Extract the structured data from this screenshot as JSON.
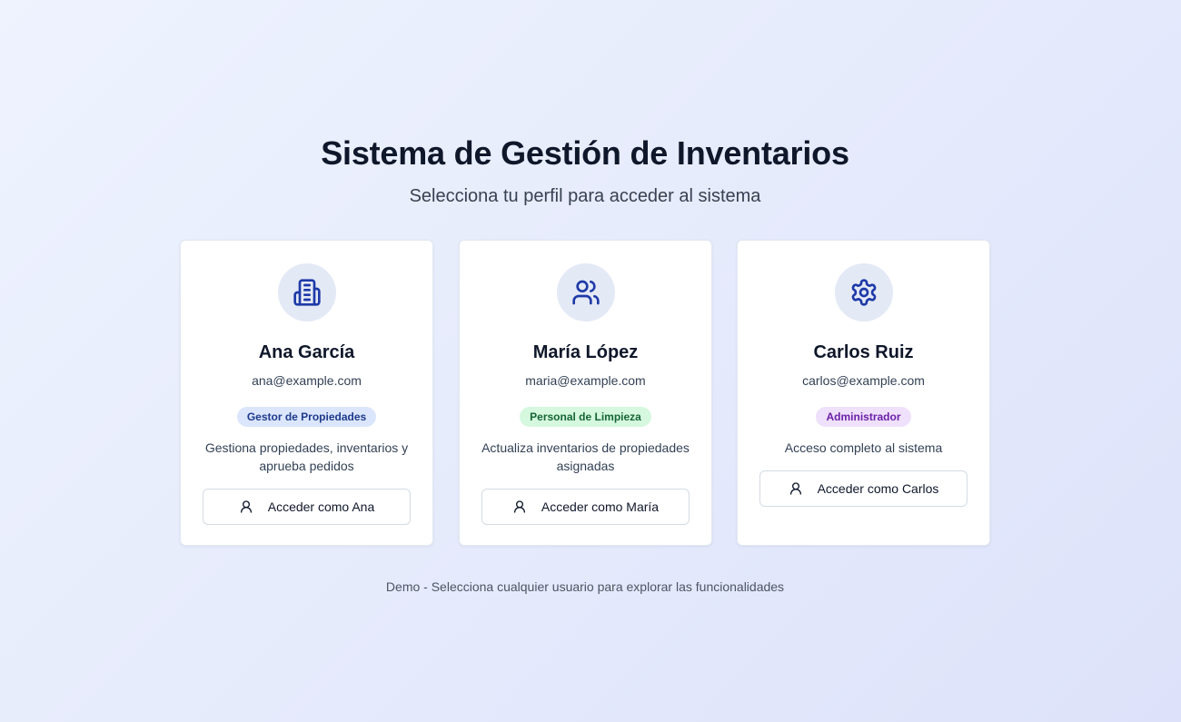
{
  "header": {
    "title": "Sistema de Gestión de Inventarios",
    "subtitle": "Selecciona tu perfil para acceder al sistema"
  },
  "profiles": [
    {
      "icon": "building-icon",
      "name": "Ana García",
      "email": "ana@example.com",
      "role": "Gestor de Propiedades",
      "role_color": "#1e3a8a",
      "description": "Gestiona propiedades, inventarios y aprueba pedidos",
      "button_label": "Acceder como Ana"
    },
    {
      "icon": "users-icon",
      "name": "María López",
      "email": "maria@example.com",
      "role": "Personal de Limpieza",
      "role_color": "#166534",
      "description": "Actualiza inventarios de propiedades asignadas",
      "button_label": "Acceder como María"
    },
    {
      "icon": "gear-icon",
      "name": "Carlos Ruiz",
      "email": "carlos@example.com",
      "role": "Administrador",
      "role_color": "#6b21a8",
      "description": "Acceso completo al sistema",
      "button_label": "Acceder como Carlos"
    }
  ],
  "colors": {
    "accent": "#1e3aa8",
    "icon_bg": "#e4e9f6"
  },
  "footer": {
    "text": "Demo - Selecciona cualquier usuario para explorar las funcionalidades"
  }
}
